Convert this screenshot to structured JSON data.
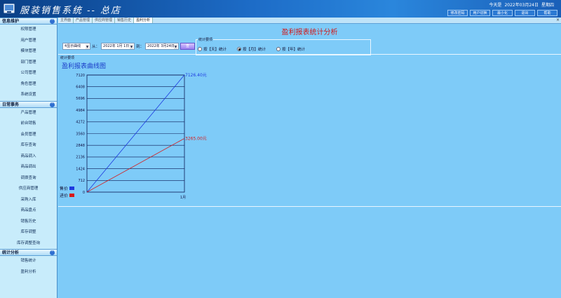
{
  "header": {
    "app_title": "服装销售系统 -- 总店",
    "date_prefix": "今天是",
    "date": "2022年03月24日",
    "weekday": "星期四",
    "buttons": [
      "修改密码",
      "用户切换",
      "最小化",
      "退出",
      "帮助"
    ]
  },
  "sidebar": {
    "sections": [
      {
        "title": "信息维护",
        "items": [
          "权限管理",
          "用户管理",
          "模块管理",
          "部门管理",
          "公司管理",
          "角色管理",
          "系统设置"
        ]
      },
      {
        "title": "日常事务",
        "items": [
          "产品管理",
          "前台销售",
          "会员管理",
          "库存查询",
          "商品调入",
          "商品调出",
          "调拨查询",
          "供应商管理",
          "采购入库",
          "商品盘点",
          "销售历史",
          "库存调整",
          "库存调整查询"
        ]
      },
      {
        "title": "统计分析",
        "items": [
          "销售统计",
          "盈利分析"
        ]
      }
    ]
  },
  "tabs": [
    "主界面",
    "产品管理",
    "供应商管理",
    "销售历史",
    "盈利分析"
  ],
  "tab_close": "×",
  "page_title": "盈利报表统计分析",
  "filter": {
    "chart_type": "4显示曲线",
    "from_label": "从：",
    "from_date": "2022年 1月 1日",
    "to_label": "到：",
    "to_date": "2022年 3月24日",
    "query_button": "查"
  },
  "stats": {
    "legend": "统计要项",
    "options": [
      "按【天】统计",
      "按【月】统计",
      "按【年】统计"
    ],
    "selected": 1
  },
  "panel": {
    "legend": "统计要项",
    "heading": "盈利报表曲线图"
  },
  "chart_data": {
    "type": "line",
    "categories": [
      "",
      "1月"
    ],
    "y_ticks": [
      0,
      712,
      1424,
      2136,
      2848,
      3560,
      4272,
      4984,
      5696,
      6408,
      7120
    ],
    "ylim": [
      0,
      7120
    ],
    "series": [
      {
        "name": "售价",
        "values": [
          0,
          7126.4
        ],
        "color": "#1d39e0",
        "end_label": "7126.40元"
      },
      {
        "name": "进价",
        "values": [
          0,
          3265.0
        ],
        "color": "#d81818",
        "end_label": "3265.00元"
      }
    ],
    "legend": [
      "售价",
      "进价"
    ]
  }
}
